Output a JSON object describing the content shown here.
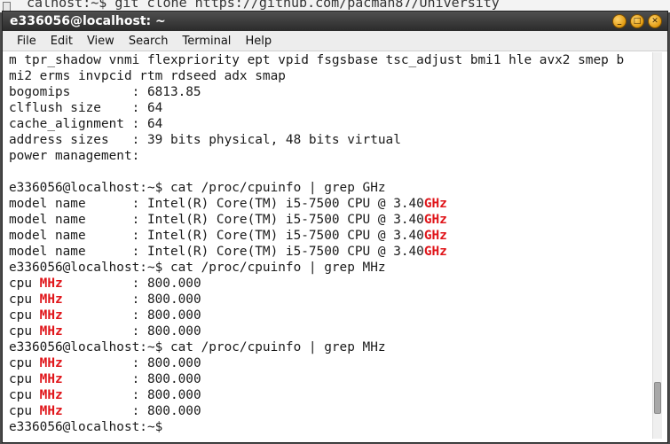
{
  "background": {
    "text": "calhost:~$ git clone https://github.com/pacman87/University"
  },
  "window": {
    "title": "e336056@localhost: ~",
    "controls": [
      {
        "name": "minimize-button",
        "glyph": "_"
      },
      {
        "name": "maximize-button",
        "glyph": "□"
      },
      {
        "name": "close-button",
        "glyph": "✕"
      }
    ]
  },
  "menu": [
    "File",
    "Edit",
    "View",
    "Search",
    "Terminal",
    "Help"
  ],
  "terminal": {
    "highlight_color": "#e0161b",
    "lines": [
      [
        {
          "t": "m tpr_shadow vnmi flexpriority ept vpid fsgsbase tsc_adjust bmi1 hle avx2 smep b"
        }
      ],
      [
        {
          "t": "mi2 erms invpcid rtm rdseed adx smap"
        }
      ],
      [
        {
          "t": "bogomips        : 6813.85"
        }
      ],
      [
        {
          "t": "clflush size    : 64"
        }
      ],
      [
        {
          "t": "cache_alignment : 64"
        }
      ],
      [
        {
          "t": "address sizes   : 39 bits physical, 48 bits virtual"
        }
      ],
      [
        {
          "t": "power management:"
        }
      ],
      [
        {
          "t": ""
        }
      ],
      [
        {
          "t": "e336056@localhost:~$ cat /proc/cpuinfo | grep GHz"
        }
      ],
      [
        {
          "t": "model name      : Intel(R) Core(TM) i5-7500 CPU @ 3.40"
        },
        {
          "t": "GHz",
          "hl": true
        }
      ],
      [
        {
          "t": "model name      : Intel(R) Core(TM) i5-7500 CPU @ 3.40"
        },
        {
          "t": "GHz",
          "hl": true
        }
      ],
      [
        {
          "t": "model name      : Intel(R) Core(TM) i5-7500 CPU @ 3.40"
        },
        {
          "t": "GHz",
          "hl": true
        }
      ],
      [
        {
          "t": "model name      : Intel(R) Core(TM) i5-7500 CPU @ 3.40"
        },
        {
          "t": "GHz",
          "hl": true
        }
      ],
      [
        {
          "t": "e336056@localhost:~$ cat /proc/cpuinfo | grep MHz"
        }
      ],
      [
        {
          "t": "cpu "
        },
        {
          "t": "MHz",
          "hl": true
        },
        {
          "t": "         : 800.000"
        }
      ],
      [
        {
          "t": "cpu "
        },
        {
          "t": "MHz",
          "hl": true
        },
        {
          "t": "         : 800.000"
        }
      ],
      [
        {
          "t": "cpu "
        },
        {
          "t": "MHz",
          "hl": true
        },
        {
          "t": "         : 800.000"
        }
      ],
      [
        {
          "t": "cpu "
        },
        {
          "t": "MHz",
          "hl": true
        },
        {
          "t": "         : 800.000"
        }
      ],
      [
        {
          "t": "e336056@localhost:~$ cat /proc/cpuinfo | grep MHz"
        }
      ],
      [
        {
          "t": "cpu "
        },
        {
          "t": "MHz",
          "hl": true
        },
        {
          "t": "         : 800.000"
        }
      ],
      [
        {
          "t": "cpu "
        },
        {
          "t": "MHz",
          "hl": true
        },
        {
          "t": "         : 800.000"
        }
      ],
      [
        {
          "t": "cpu "
        },
        {
          "t": "MHz",
          "hl": true
        },
        {
          "t": "         : 800.000"
        }
      ],
      [
        {
          "t": "cpu "
        },
        {
          "t": "MHz",
          "hl": true
        },
        {
          "t": "         : 800.000"
        }
      ],
      [
        {
          "t": "e336056@localhost:~$ "
        }
      ]
    ]
  },
  "scrollbar": {
    "thumb_position_fraction": 0.93
  }
}
